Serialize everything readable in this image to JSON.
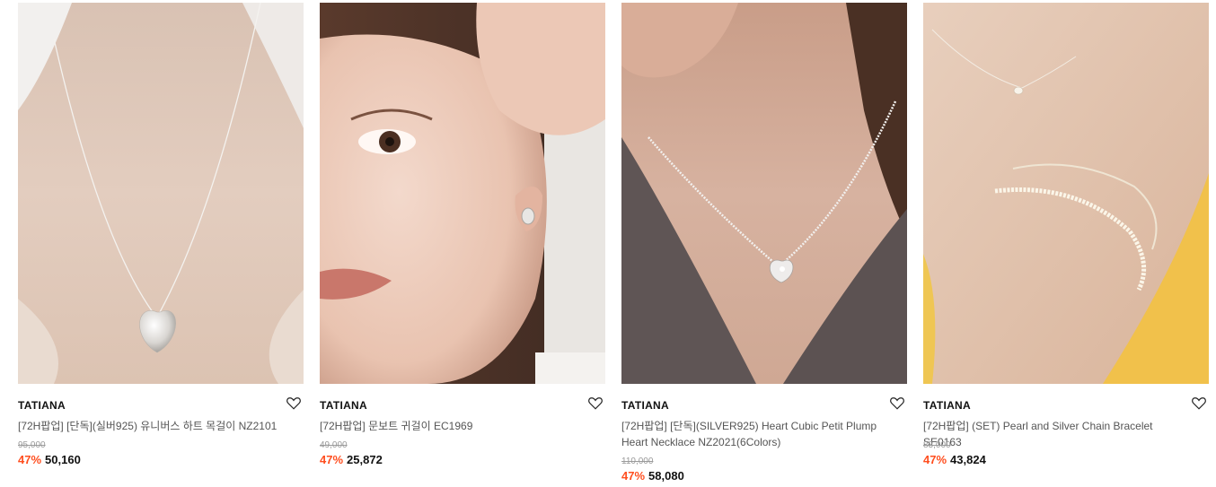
{
  "products": [
    {
      "brand": "TATIANA",
      "title": "[72H팝업] [단독](실버925) 유니버스 하트 목걸이 NZ2101",
      "original_price": "95,000",
      "discount": "47%",
      "sale_price": "50,160",
      "image": "necklace-heart-pendant-photo",
      "wish_icon": "heart-outline-icon"
    },
    {
      "brand": "TATIANA",
      "title": "[72H팝업] 문보트 귀걸이 EC1969",
      "original_price": "49,000",
      "discount": "47%",
      "sale_price": "25,872",
      "image": "earring-model-photo",
      "wish_icon": "heart-outline-icon"
    },
    {
      "brand": "TATIANA",
      "title": "[72H팝업] [단독](SILVER925) Heart Cubic Petit Plump Heart Necklace NZ2021(6Colors)",
      "original_price": "110,000",
      "discount": "47%",
      "sale_price": "58,080",
      "image": "ball-chain-heart-necklace-photo",
      "wish_icon": "heart-outline-icon"
    },
    {
      "brand": "TATIANA",
      "title": "[72H팝업] (SET) Pearl and Silver Chain Bracelet SE0163",
      "original_price": "83,000",
      "discount": "47%",
      "sale_price": "43,824",
      "image": "pearl-bracelet-photo",
      "wish_icon": "heart-outline-icon"
    }
  ],
  "colors": {
    "discount": "#ff4e1f",
    "brand": "#111111",
    "title": "#555555",
    "original_price": "#9a9a9a"
  }
}
